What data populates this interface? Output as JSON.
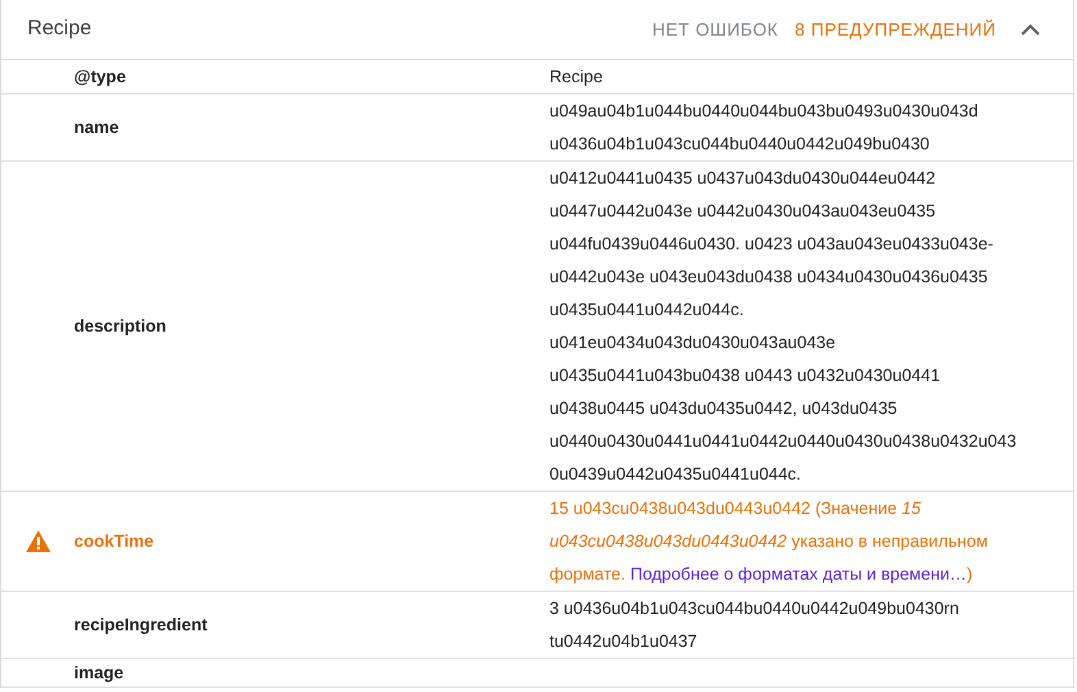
{
  "card": {
    "title": "Recipe",
    "errors": "НЕТ ОШИБОК",
    "warnings": "8 ПРЕДУПРЕЖДЕНИЙ",
    "expanded": true
  },
  "rows": [
    {
      "kind": "plain",
      "label": "@type",
      "lines": [
        "Recipe"
      ]
    },
    {
      "kind": "plain",
      "label": "name",
      "lines": [
        "u049au04b1u044bu0440u044bu043bu0493u0430u043d",
        "u0436u04b1u043cu044bu0440u0442u049bu0430"
      ]
    },
    {
      "kind": "plain",
      "label": "description",
      "lines": [
        "u0412u0441u0435 u0437u043du0430u044eu0442",
        "u0447u0442u043e u0442u0430u043au043eu0435",
        "u044fu0439u0446u0430. u0423 u043au043eu0433u043e-",
        "u0442u043e u043eu043du0438 u0434u0430u0436u0435",
        "u0435u0441u0442u044c.",
        "u041eu0434u043du0430u043au043e",
        "u0435u0441u043bu0438 u0443 u0432u0430u0441",
        "u0438u0445 u043du0435u0442, u043du0435",
        "u0440u0430u0441u0441u0442u0440u0430u0438u0432u043",
        "0u0439u0442u0435u0441u044c."
      ]
    },
    {
      "kind": "warning",
      "label": "cookTime",
      "message": "15 u043cu0438u043du0443u0442 (Значение *15 u043cu0438u043du0443u0442* указано в неправильном формате.",
      "link": "Подробнее о форматах даты и времени…",
      "tail": ")"
    },
    {
      "kind": "plain",
      "label": "recipeIngredient",
      "lines": [
        "3 u0436u04b1u043cu044bu0440u0442u049bu0430rn",
        "tu0442u04b1u0437"
      ]
    },
    {
      "kind": "plain",
      "label": "image",
      "lines": []
    }
  ]
}
